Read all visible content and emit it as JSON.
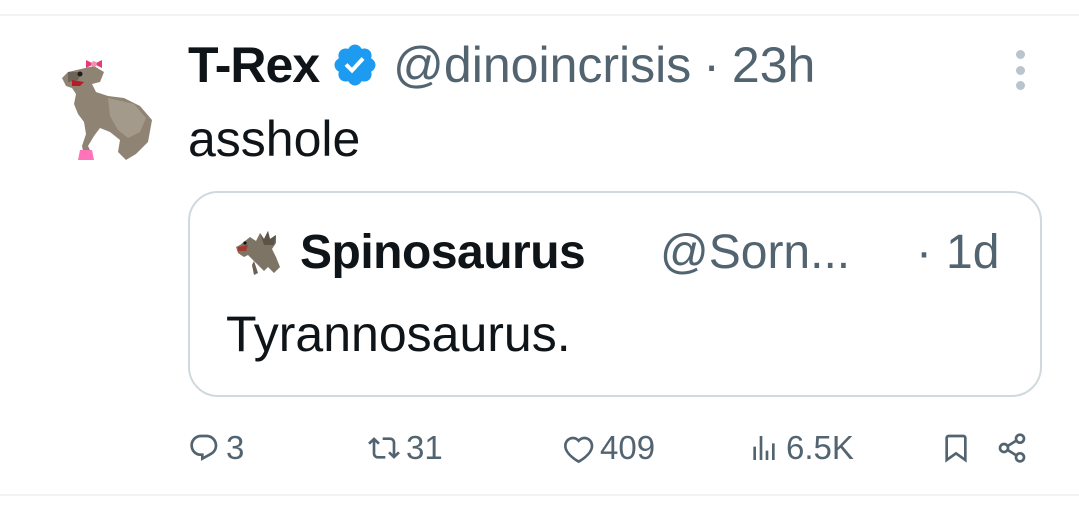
{
  "tweet": {
    "author": {
      "display_name": "T-Rex",
      "handle": "@dinoincrisis",
      "verified_icon": "verified-badge-icon",
      "avatar": "t-rex-avatar"
    },
    "separator": "·",
    "time": "23h",
    "text": "asshole",
    "more_icon": "more-options-icon"
  },
  "quote": {
    "author": {
      "display_name": "Spinosaurus",
      "handle": "@Sorn...",
      "avatar": "spinosaurus-avatar"
    },
    "separator": "·",
    "time": "1d",
    "text": "Tyrannosaurus."
  },
  "actions": {
    "reply_count": "3",
    "retweet_count": "31",
    "like_count": "409",
    "views_count": "6.5K",
    "icons": [
      "reply-icon",
      "retweet-icon",
      "like-icon",
      "views-icon",
      "bookmark-icon",
      "share-icon"
    ]
  },
  "colors": {
    "text_primary": "#0f1419",
    "text_secondary": "#536471",
    "verified_blue": "#1d9bf0",
    "border": "#cfd9de",
    "divider": "#eff3f4"
  }
}
